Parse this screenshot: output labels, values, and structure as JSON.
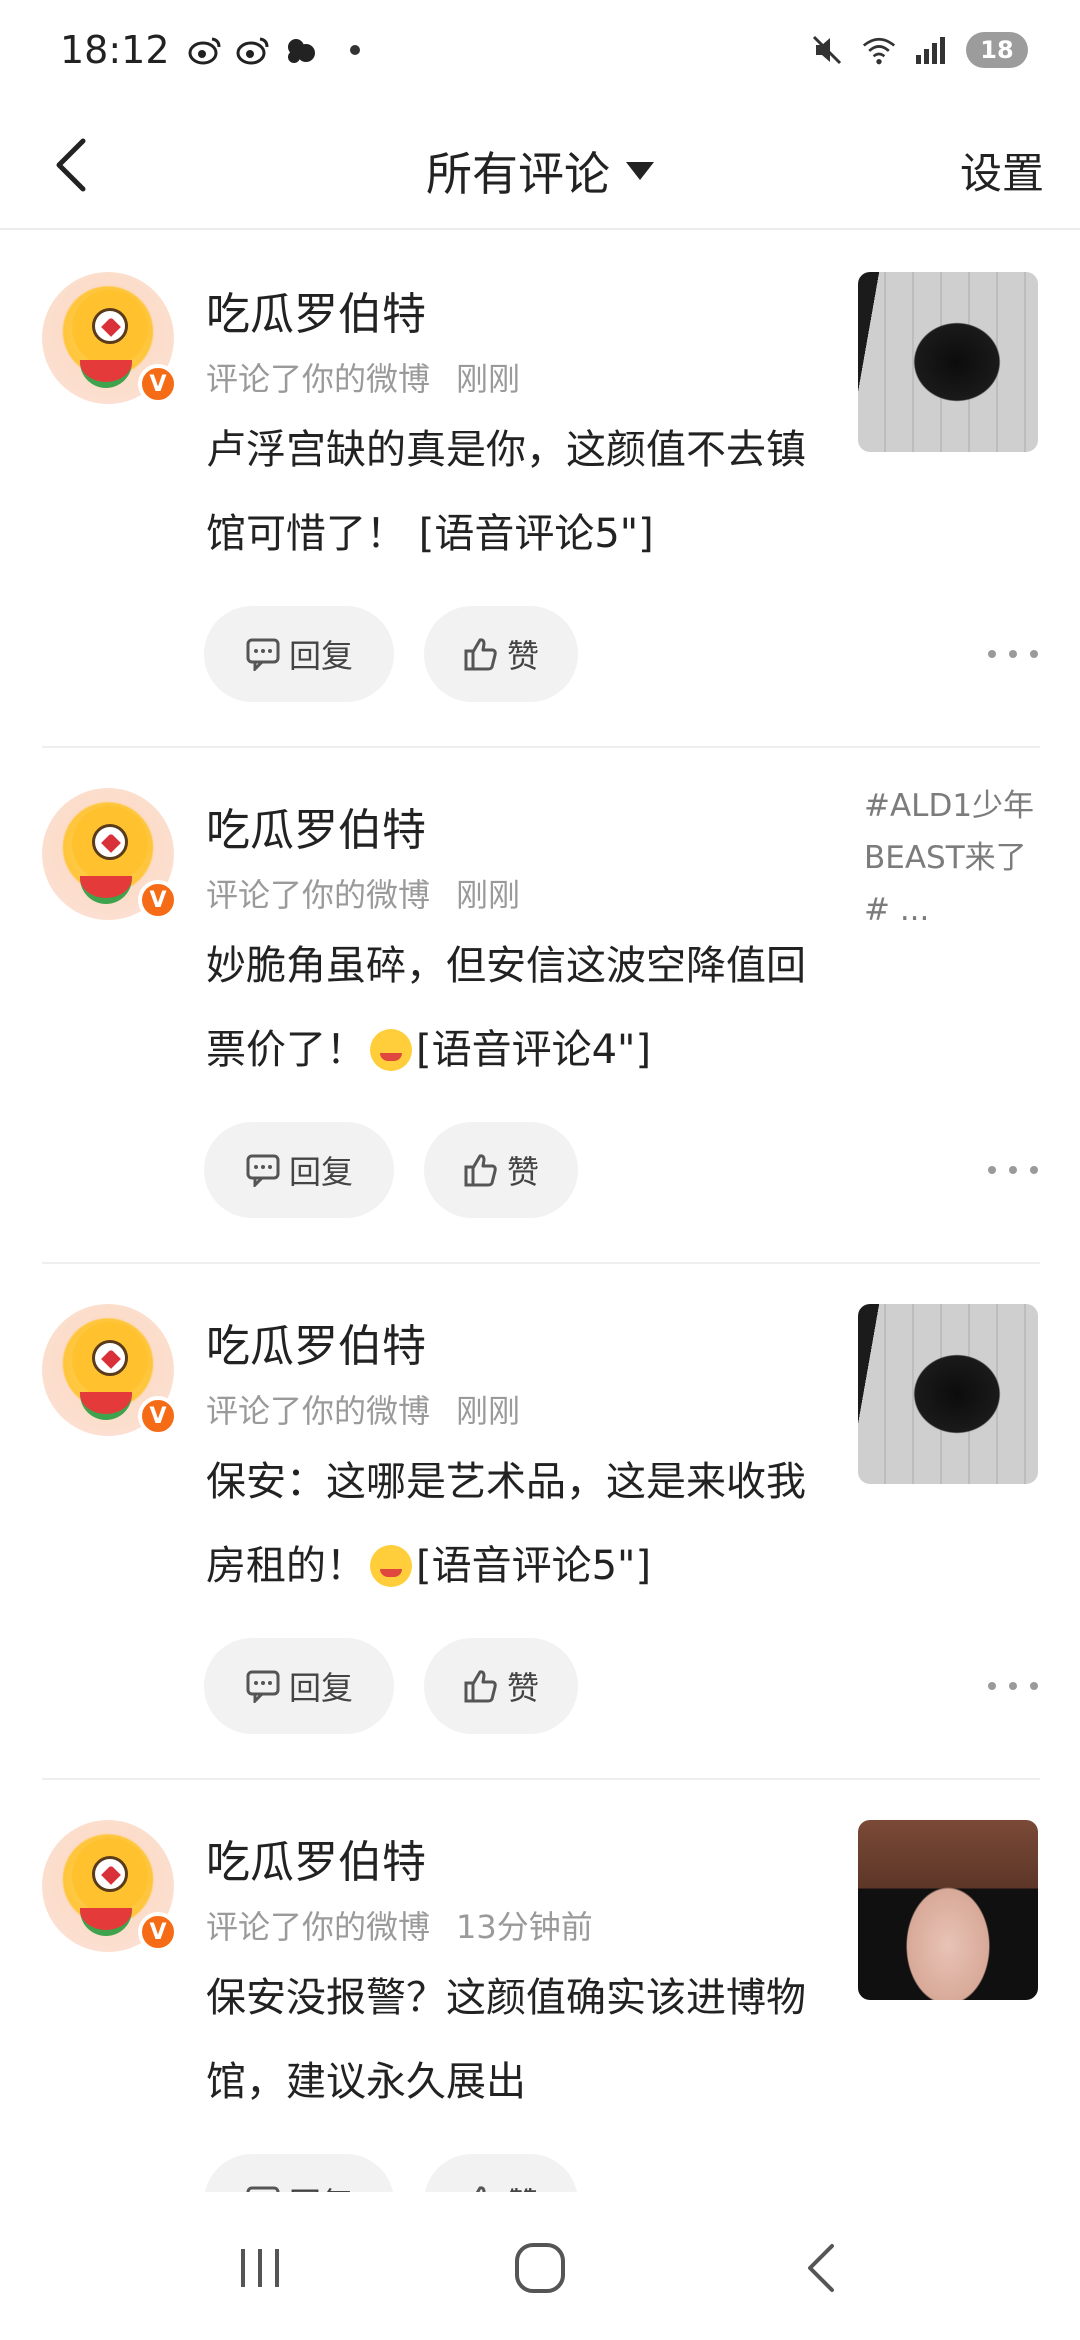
{
  "status_bar": {
    "time": "18:12",
    "battery": "18",
    "left_icons": [
      "weibo-icon",
      "weibo-icon",
      "cloud-icon"
    ],
    "right_icons": [
      "mute-icon",
      "wifi-icon",
      "signal-icon"
    ]
  },
  "header": {
    "title": "所有评论",
    "settings_label": "设置"
  },
  "comments": [
    {
      "username": "吃瓜罗伯特",
      "action": "评论了你的微博",
      "time": "刚刚",
      "text": "卢浮宫缺的真是你，这颜值不去镇馆可惜了！ [语音评论5\"]",
      "reply_label": "回复",
      "like_label": "赞",
      "thumb_type": "bw-photo"
    },
    {
      "username": "吃瓜罗伯特",
      "action": "评论了你的微博",
      "time": "刚刚",
      "text_before_emoji": "妙脆角虽碎，但安信这波空降值回票价了！",
      "text_after_emoji": "[语音评论4\"]",
      "reply_label": "回复",
      "like_label": "赞",
      "topic_text": "#ALD1少年BEAST来了# ..."
    },
    {
      "username": "吃瓜罗伯特",
      "action": "评论了你的微博",
      "time": "刚刚",
      "text_before_emoji": "保安：这哪是艺术品，这是来收我房租的！",
      "text_after_emoji": "[语音评论5\"]",
      "reply_label": "回复",
      "like_label": "赞",
      "thumb_type": "bw-photo"
    },
    {
      "username": "吃瓜罗伯特",
      "action": "评论了你的微博",
      "time": "13分钟前",
      "text": "保安没报警？这颜值确实该进博物馆，建议永久展出",
      "reply_label": "回复",
      "like_label": "赞",
      "thumb_type": "color-photo"
    }
  ],
  "colors": {
    "accent_badge": "#f66b16",
    "secondary_text": "#9a9a9a",
    "pill_bg": "#f2f2f2"
  }
}
